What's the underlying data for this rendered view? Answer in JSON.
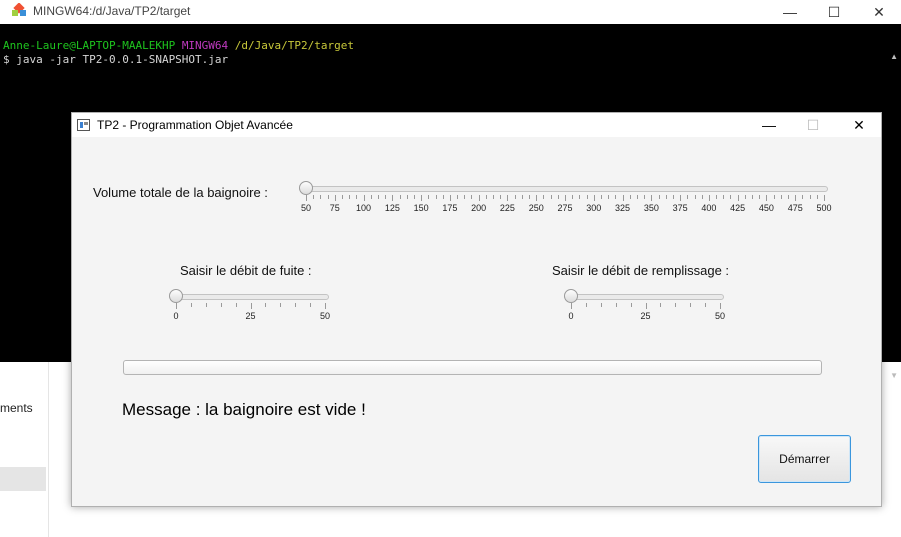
{
  "background_app": {
    "sidebar_text": "ments"
  },
  "terminal": {
    "title": "MINGW64:/d/Java/TP2/target",
    "prompt_user": "Anne-Laure@LAPTOP-MAALEKHP",
    "prompt_env": "MINGW64",
    "prompt_path": "/d/Java/TP2/target",
    "command": "$ java -jar TP2-0.0.1-SNAPSHOT.jar",
    "controls": {
      "minimize": "—",
      "maximize": "☐",
      "close": "✕"
    }
  },
  "dialog": {
    "title": "TP2 - Programmation Objet Avancée",
    "controls": {
      "minimize": "—",
      "maximize": "☐",
      "close": "✕"
    },
    "volume": {
      "label": "Volume totale de la baignoire :",
      "min": 50,
      "max": 500,
      "value": 50,
      "tick_labels": [
        "50",
        "75",
        "100",
        "125",
        "150",
        "175",
        "200",
        "225",
        "250",
        "275",
        "300",
        "325",
        "350",
        "375",
        "400",
        "425",
        "450",
        "475",
        "500"
      ]
    },
    "leak": {
      "label": "Saisir le débit de fuite :",
      "min": 0,
      "max": 50,
      "value": 0,
      "tick_labels": [
        "0",
        "25",
        "50"
      ]
    },
    "fill": {
      "label": "Saisir le débit de remplissage :",
      "min": 0,
      "max": 50,
      "value": 0,
      "tick_labels": [
        "0",
        "25",
        "50"
      ]
    },
    "progress": 0,
    "message": "Message : la baignoire est vide !",
    "start_button": "Démarrer"
  },
  "colors": {
    "accent": "#3a96dd",
    "terminal_bg": "#000000",
    "prompt_green": "#1ec51e",
    "prompt_magenta": "#c03ac0",
    "prompt_yellow": "#c8c83a"
  }
}
